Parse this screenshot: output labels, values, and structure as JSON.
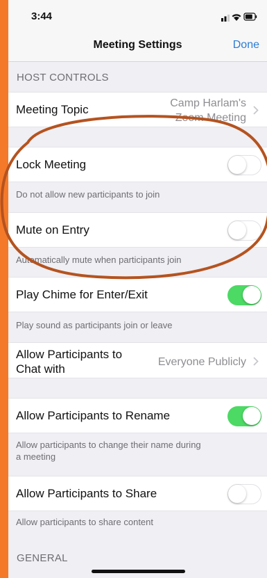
{
  "status_bar": {
    "time": "3:44"
  },
  "nav": {
    "title": "Meeting Settings",
    "done_label": "Done"
  },
  "sections": {
    "host_controls": "HOST CONTROLS",
    "general": "GENERAL"
  },
  "meeting_topic": {
    "label": "Meeting Topic",
    "value_line1": "Camp Harlam's",
    "value_line2": "Zoom Meeting"
  },
  "lock_meeting": {
    "label": "Lock Meeting",
    "enabled": false,
    "footnote": "Do not allow new participants to join"
  },
  "mute_on_entry": {
    "label": "Mute on Entry",
    "enabled": false,
    "footnote": "Automatically mute when participants join"
  },
  "play_chime": {
    "label": "Play Chime for Enter/Exit",
    "enabled": true,
    "footnote": "Play sound as participants join or leave"
  },
  "allow_chat": {
    "label_line1": "Allow Participants to",
    "label_line2": "Chat with",
    "value": "Everyone Publicly"
  },
  "allow_rename": {
    "label": "Allow Participants to Rename",
    "enabled": true,
    "footnote_line1": "Allow participants to change their name during",
    "footnote_line2": "a meeting"
  },
  "allow_share": {
    "label": "Allow Participants to Share",
    "enabled": false,
    "footnote": "Allow participants to share content"
  },
  "colors": {
    "frame": "#f47a2a",
    "toggle_on": "#4cd964",
    "link_blue": "#2b7bd6",
    "annotation": "#b5531f"
  }
}
